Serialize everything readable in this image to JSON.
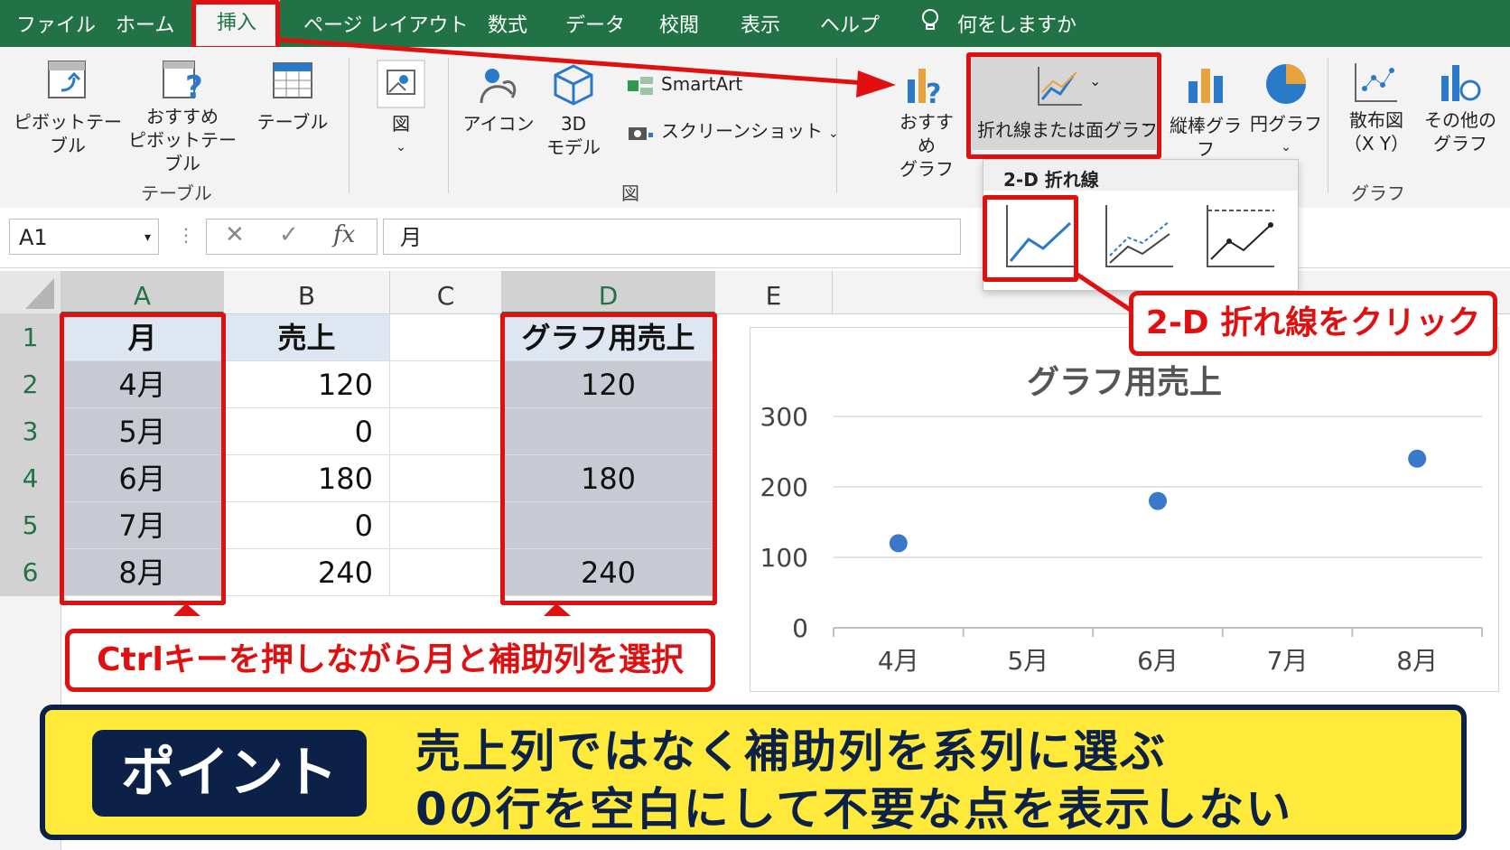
{
  "menu": {
    "file": "ファイル",
    "home": "ホーム",
    "insert": "挿入",
    "page_layout": "ページ レイアウト",
    "formulas": "数式",
    "data": "データ",
    "review": "校閲",
    "view": "表示",
    "help": "ヘルプ",
    "tell_me": "何をしますか"
  },
  "ribbon": {
    "pivot_table": "ピボットテーブル",
    "recommended_pivot_l1": "おすすめ",
    "recommended_pivot_l2": "ピボットテーブル",
    "table": "テーブル",
    "group_table": "テーブル",
    "figure": "図",
    "icons": "アイコン",
    "model3d_l1": "3D",
    "model3d_l2": "モデル",
    "smartart": "SmartArt",
    "screenshot": "スクリーンショット",
    "group_figure": "図",
    "recommended_chart_l1": "おすすめ",
    "recommended_chart_l2": "グラフ",
    "line_area_chart": "折れ線または面グラフ",
    "column_chart": "縦棒グラフ",
    "pie_chart": "円グラフ",
    "scatter_l1": "散布図",
    "scatter_l2": "（X Y）",
    "other_l1": "その他の",
    "other_l2": "グラフ",
    "group_chart": "グラフ"
  },
  "dropdown": {
    "title": "2-D 折れ線"
  },
  "formula_bar": {
    "name_box": "A1",
    "fx": "fx",
    "content": "月"
  },
  "columns": [
    "A",
    "B",
    "C",
    "D",
    "E"
  ],
  "rows": [
    "1",
    "2",
    "3",
    "4",
    "5",
    "6"
  ],
  "sheet": {
    "header_month": "月",
    "header_sales": "売上",
    "header_graph_sales": "グラフ用売上",
    "months": [
      "4月",
      "5月",
      "6月",
      "7月",
      "8月"
    ],
    "sales": [
      "120",
      "0",
      "180",
      "0",
      "240"
    ],
    "graph_sales": [
      "120",
      "",
      "180",
      "",
      "240"
    ]
  },
  "callouts": {
    "click_2d_line": "2-D 折れ線をクリック",
    "ctrl_select": "Ctrlキーを押しながら月と補助列を選択"
  },
  "point": {
    "tag": "ポイント",
    "line1": "売上列ではなく補助列を系列に選ぶ",
    "line2": "0の行を空白にして不要な点を表示しない"
  },
  "chart_data": {
    "type": "line",
    "title": "グラフ用売上",
    "categories": [
      "4月",
      "5月",
      "6月",
      "7月",
      "8月"
    ],
    "values": [
      120,
      null,
      180,
      null,
      240
    ],
    "ylim": [
      0,
      300
    ],
    "yticks": [
      "0",
      "100",
      "200",
      "300"
    ],
    "grid": true,
    "marker_color": "#3a78c9"
  },
  "colors": {
    "excel_green": "#217346",
    "highlight_red": "#e01010",
    "banner_yellow": "#ffe93a",
    "banner_navy": "#0b2148"
  }
}
